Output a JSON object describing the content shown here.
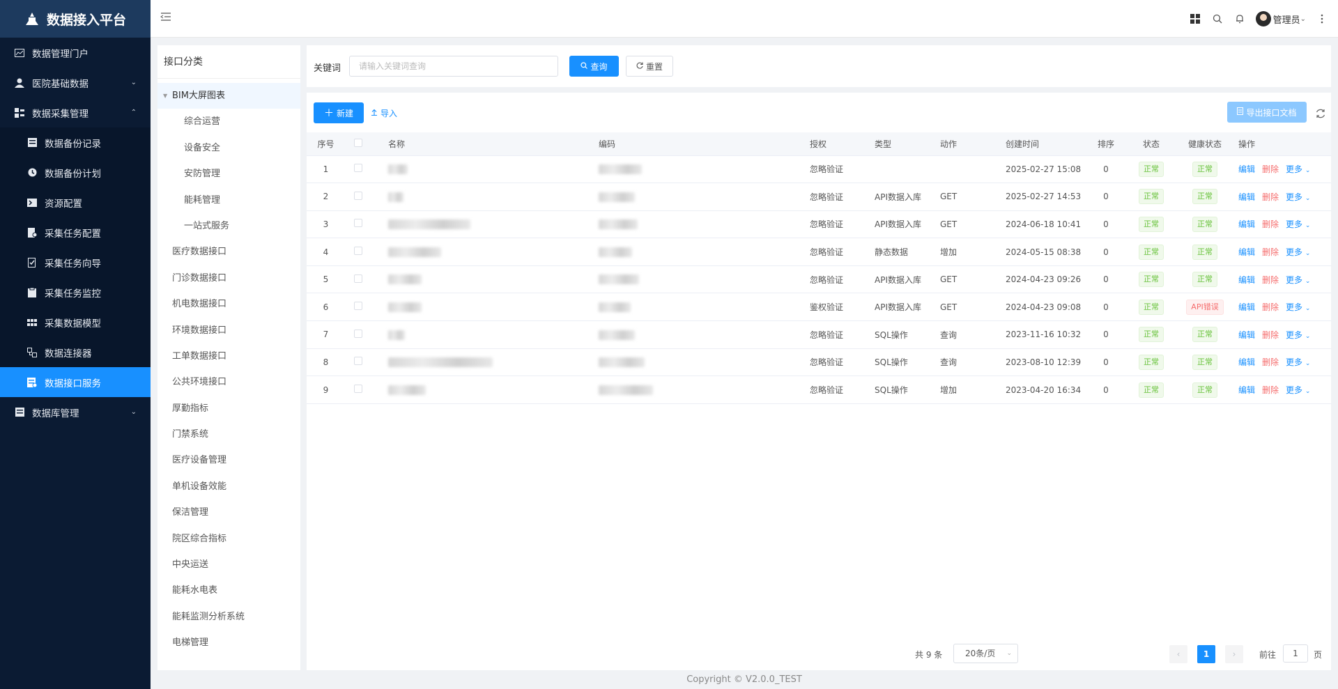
{
  "app": {
    "title": "数据接入平台"
  },
  "sidebar": {
    "items": [
      {
        "label": "数据管理门户",
        "icon": "chart-icon"
      },
      {
        "label": "医院基础数据",
        "icon": "user-icon"
      },
      {
        "label": "数据采集管理",
        "icon": "collect-icon"
      },
      {
        "label": "数据库管理",
        "icon": "database-icon"
      }
    ],
    "sub_items": [
      {
        "label": "数据备份记录"
      },
      {
        "label": "数据备份计划"
      },
      {
        "label": "资源配置"
      },
      {
        "label": "采集任务配置"
      },
      {
        "label": "采集任务向导"
      },
      {
        "label": "采集任务监控"
      },
      {
        "label": "采集数据模型"
      },
      {
        "label": "数据连接器"
      },
      {
        "label": "数据接口服务"
      }
    ],
    "active": "数据接口服务"
  },
  "topbar": {
    "user": "管理员"
  },
  "tree": {
    "title": "接口分类",
    "parent": "BIM大屏图表",
    "children": [
      "综合运营",
      "设备安全",
      "安防管理",
      "能耗管理",
      "一站式服务"
    ],
    "items": [
      "医疗数据接口",
      "门诊数据接口",
      "机电数据接口",
      "环境数据接口",
      "工单数据接口",
      "公共环境接口",
      "厚勤指标",
      "门禁系统",
      "医疗设备管理",
      "单机设备效能",
      "保洁管理",
      "院区综合指标",
      "中央运送",
      "能耗水电表",
      "能耗监测分析系统",
      "电梯管理"
    ]
  },
  "search": {
    "label": "关键词",
    "placeholder": "请输入关键词查询",
    "query_btn": "查询",
    "reset_btn": "重置"
  },
  "toolbar": {
    "new_btn": "新建",
    "import_btn": "导入",
    "export_btn": "导出接口文档"
  },
  "table": {
    "headers": [
      "序号",
      "",
      "名称",
      "编码",
      "授权",
      "类型",
      "动作",
      "创建时间",
      "排序",
      "状态",
      "健康状态",
      "操作"
    ],
    "rows": [
      {
        "no": "1",
        "auth": "忽略验证",
        "type": "",
        "action": "",
        "created": "2025-02-27 15:08",
        "sort": "0",
        "status": "正常",
        "health": "正常",
        "health_err": false
      },
      {
        "no": "2",
        "auth": "忽略验证",
        "type": "API数据入库",
        "action": "GET",
        "created": "2025-02-27 14:53",
        "sort": "0",
        "status": "正常",
        "health": "正常",
        "health_err": false
      },
      {
        "no": "3",
        "auth": "忽略验证",
        "type": "API数据入库",
        "action": "GET",
        "created": "2024-06-18 10:41",
        "sort": "0",
        "status": "正常",
        "health": "正常",
        "health_err": false
      },
      {
        "no": "4",
        "auth": "忽略验证",
        "type": "静态数据",
        "action": "增加",
        "created": "2024-05-15 08:38",
        "sort": "0",
        "status": "正常",
        "health": "正常",
        "health_err": false
      },
      {
        "no": "5",
        "auth": "忽略验证",
        "type": "API数据入库",
        "action": "GET",
        "created": "2024-04-23 09:26",
        "sort": "0",
        "status": "正常",
        "health": "正常",
        "health_err": false
      },
      {
        "no": "6",
        "auth": "鉴权验证",
        "type": "API数据入库",
        "action": "GET",
        "created": "2024-04-23 09:08",
        "sort": "0",
        "status": "正常",
        "health": "API错误",
        "health_err": true
      },
      {
        "no": "7",
        "auth": "忽略验证",
        "type": "SQL操作",
        "action": "查询",
        "created": "2023-11-16 10:32",
        "sort": "0",
        "status": "正常",
        "health": "正常",
        "health_err": false
      },
      {
        "no": "8",
        "auth": "忽略验证",
        "type": "SQL操作",
        "action": "查询",
        "created": "2023-08-10 12:39",
        "sort": "0",
        "status": "正常",
        "health": "正常",
        "health_err": false
      },
      {
        "no": "9",
        "auth": "忽略验证",
        "type": "SQL操作",
        "action": "增加",
        "created": "2023-04-20 16:34",
        "sort": "0",
        "status": "正常",
        "health": "正常",
        "health_err": false
      }
    ],
    "ops": {
      "edit": "编辑",
      "delete": "删除",
      "more": "更多"
    }
  },
  "pager": {
    "total": "共 9 条",
    "page_size": "20条/页",
    "current": "1",
    "goto": "前往",
    "goto_value": "1",
    "page_unit": "页"
  },
  "footer": {
    "copyright": "Copyright © V2.0.0_TEST"
  },
  "colors": {
    "primary": "#1890ff",
    "sidebar_bg": "#0b1b33",
    "success": "#67c23a",
    "danger": "#f56c6c"
  }
}
